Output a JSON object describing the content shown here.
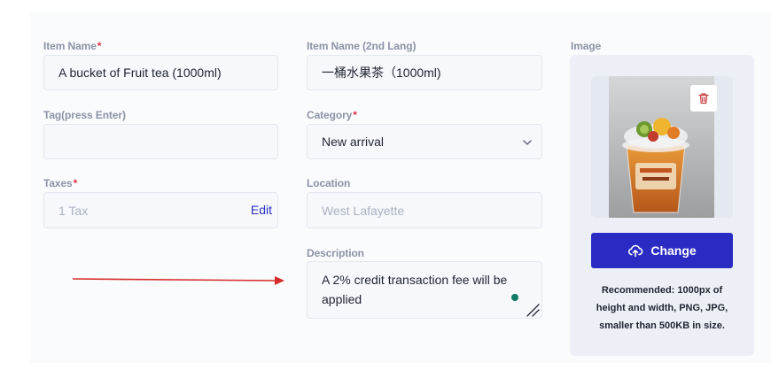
{
  "form": {
    "item_name": {
      "label": "Item Name",
      "required": "*",
      "value": "A bucket of Fruit tea (1000ml)"
    },
    "item_name_2nd": {
      "label": "Item Name (2nd Lang)",
      "value": "一桶水果茶（1000ml)"
    },
    "tag": {
      "label": "Tag(press Enter)",
      "value": ""
    },
    "category": {
      "label": "Category",
      "required": "*",
      "value": "New arrival"
    },
    "taxes": {
      "label": "Taxes",
      "required": "*",
      "value": "1 Tax",
      "edit_label": "Edit"
    },
    "location": {
      "label": "Location",
      "value": "West Lafayette"
    },
    "description": {
      "label": "Description",
      "value": "A 2% credit transaction fee will be applied"
    }
  },
  "image": {
    "label": "Image",
    "change_label": "Change",
    "recommendation": "Recommended: 1000px of height and width, PNG, JPG, smaller than 500KB in size."
  },
  "colors": {
    "accent": "#2a2bc3",
    "required": "#e0334b",
    "arrow": "#d62b2b",
    "status_dot": "#0f7b64"
  },
  "icons": [
    "trash-icon",
    "upload-cloud-icon",
    "chevron-down-icon",
    "resize-grip-icon",
    "arrow-right-icon"
  ]
}
